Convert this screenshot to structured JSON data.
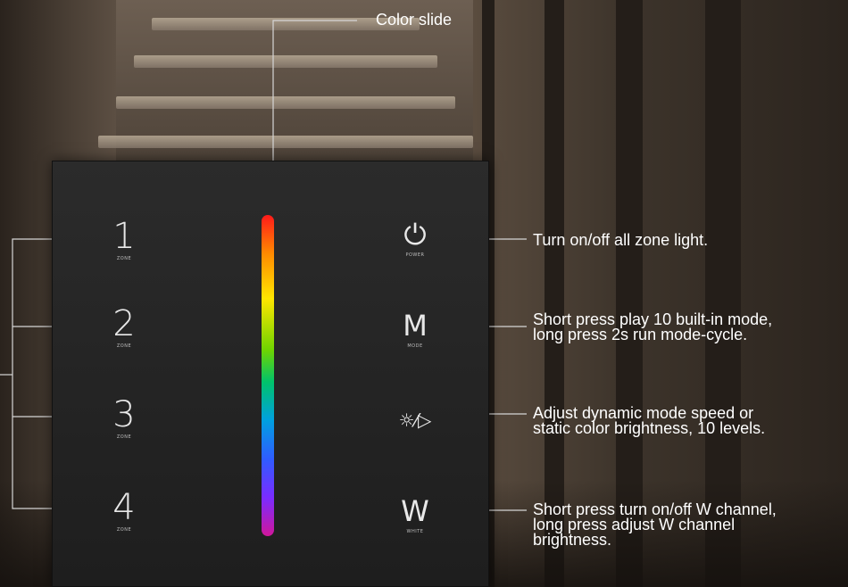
{
  "callouts": {
    "color_slide": "Color slide",
    "power": "Turn on/off all zone light.",
    "mode_line1": "Short press play 10 built-in mode,",
    "mode_line2": "long press 2s run mode-cycle.",
    "speed_line1": "Adjust dynamic mode speed or",
    "speed_line2": "static color brightness, 10 levels.",
    "white_line1": "Short press turn on/off W channel,",
    "white_line2": "long press adjust W channel",
    "white_line3": "brightness."
  },
  "zones": [
    {
      "number": "1",
      "sub": "ZONE"
    },
    {
      "number": "2",
      "sub": "ZONE"
    },
    {
      "number": "3",
      "sub": "ZONE"
    },
    {
      "number": "4",
      "sub": "ZONE"
    }
  ],
  "functions": {
    "power": {
      "symbol": "⏻",
      "sub": "POWER",
      "icon": "power-icon"
    },
    "mode": {
      "symbol": "M",
      "sub": "MODE"
    },
    "speed": {
      "symbol": "☼⁄▷",
      "icon": "brightness-speed-icon"
    },
    "white": {
      "symbol": "W",
      "sub": "WHITE"
    }
  },
  "colors": {
    "panel": "#242424",
    "callout_line": "#d9d9d9",
    "text": "#ffffff"
  }
}
